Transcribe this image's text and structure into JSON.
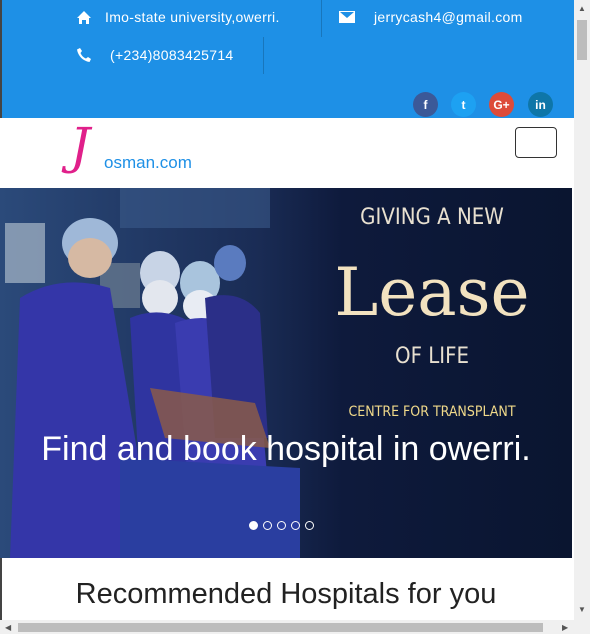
{
  "contact": {
    "address": "Imo-state university,owerri.",
    "email": "jerrycash4@gmail.com",
    "phone": "(+234)8083425714"
  },
  "social": [
    {
      "name": "facebook",
      "glyph": "f",
      "color": "#3b5998"
    },
    {
      "name": "twitter",
      "glyph": "t",
      "color": "#1da1f2"
    },
    {
      "name": "google-plus",
      "glyph": "G+",
      "color": "#dd4b39"
    },
    {
      "name": "linkedin",
      "glyph": "in",
      "color": "#0e76a8"
    }
  ],
  "brand": {
    "initial": "J",
    "rest": "osman.com"
  },
  "hero": {
    "line1": "GIVING A NEW",
    "line2": "Lease",
    "line3": "OF LIFE",
    "line4": "CENTRE FOR TRANSPLANT",
    "caption": "Find and book hospital in owerri.",
    "slides": 5,
    "active_slide": 1
  },
  "section_title": "Recommended Hospitals for you",
  "colors": {
    "topbar": "#1e90e6",
    "brand_pink": "#e0208a",
    "brand_blue": "#1e90e6"
  }
}
